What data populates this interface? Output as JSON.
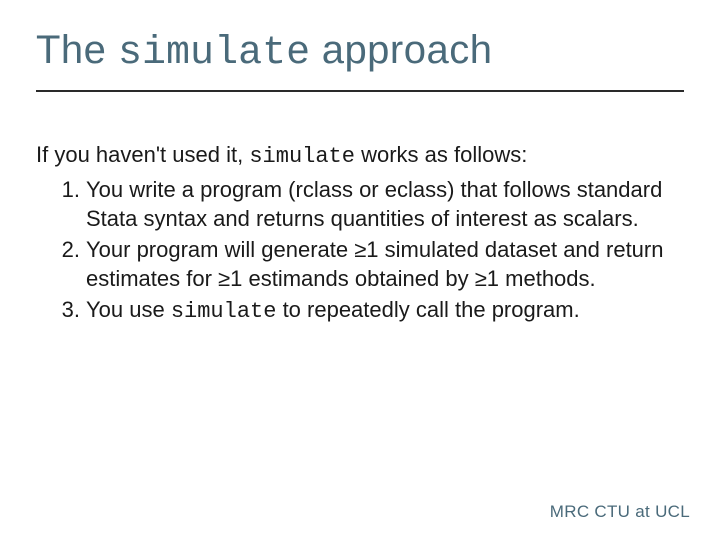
{
  "title": {
    "pre": "The ",
    "code": "simulate",
    "post": " approach"
  },
  "intro": {
    "pre": "If you haven't used it, ",
    "code": "simulate",
    "post": " works as follows:"
  },
  "items": [
    {
      "num": "1.",
      "text": "You write a program (rclass or eclass) that follows standard Stata syntax and returns quantities of interest as scalars."
    },
    {
      "num": "2.",
      "text": "Your program will generate ≥1 simulated dataset and return estimates for ≥1 estimands obtained by ≥1 methods."
    },
    {
      "num": "3.",
      "pre": "You use ",
      "code": "simulate",
      "post": " to repeatedly call the program."
    }
  ],
  "footer": "MRC CTU at UCL"
}
